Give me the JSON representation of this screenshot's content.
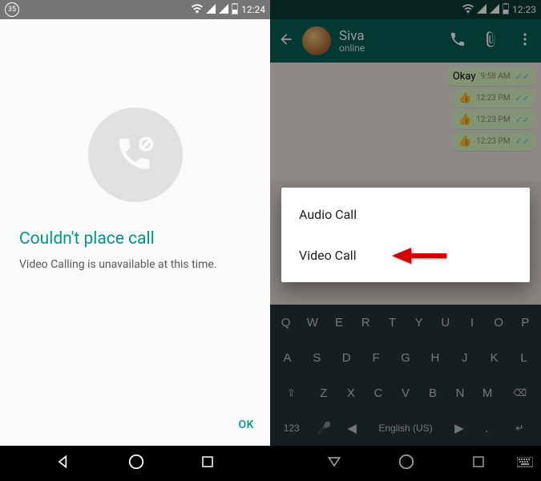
{
  "left": {
    "status": {
      "badge": "35",
      "time": "12:24"
    },
    "error_title": "Couldn't place call",
    "error_subtitle": "Video Calling is unavailable at this time.",
    "ok_label": "OK"
  },
  "right": {
    "status": {
      "time": "12:23"
    },
    "header": {
      "name": "Siva",
      "status": "online"
    },
    "messages": [
      {
        "text": "Okay",
        "time": "9:58 AM"
      },
      {
        "emoji": "👍",
        "time": "12:23 PM"
      },
      {
        "emoji": "👍",
        "time": "12:23 PM"
      },
      {
        "emoji": "👍",
        "time": "12:23 PM"
      }
    ],
    "popup": {
      "audio": "Audio Call",
      "video": "Video Call"
    },
    "keyboard": {
      "row1": [
        "Q",
        "W",
        "E",
        "R",
        "T",
        "Y",
        "U",
        "I",
        "O",
        "P"
      ],
      "row2": [
        "A",
        "S",
        "D",
        "F",
        "G",
        "H",
        "J",
        "K",
        "L"
      ],
      "row3_shift": "⇧",
      "row3": [
        "Z",
        "X",
        "C",
        "V",
        "B",
        "N",
        "M"
      ],
      "row3_del": "⌫",
      "row4_sym": "123",
      "row4_lang": "English (US)"
    }
  }
}
